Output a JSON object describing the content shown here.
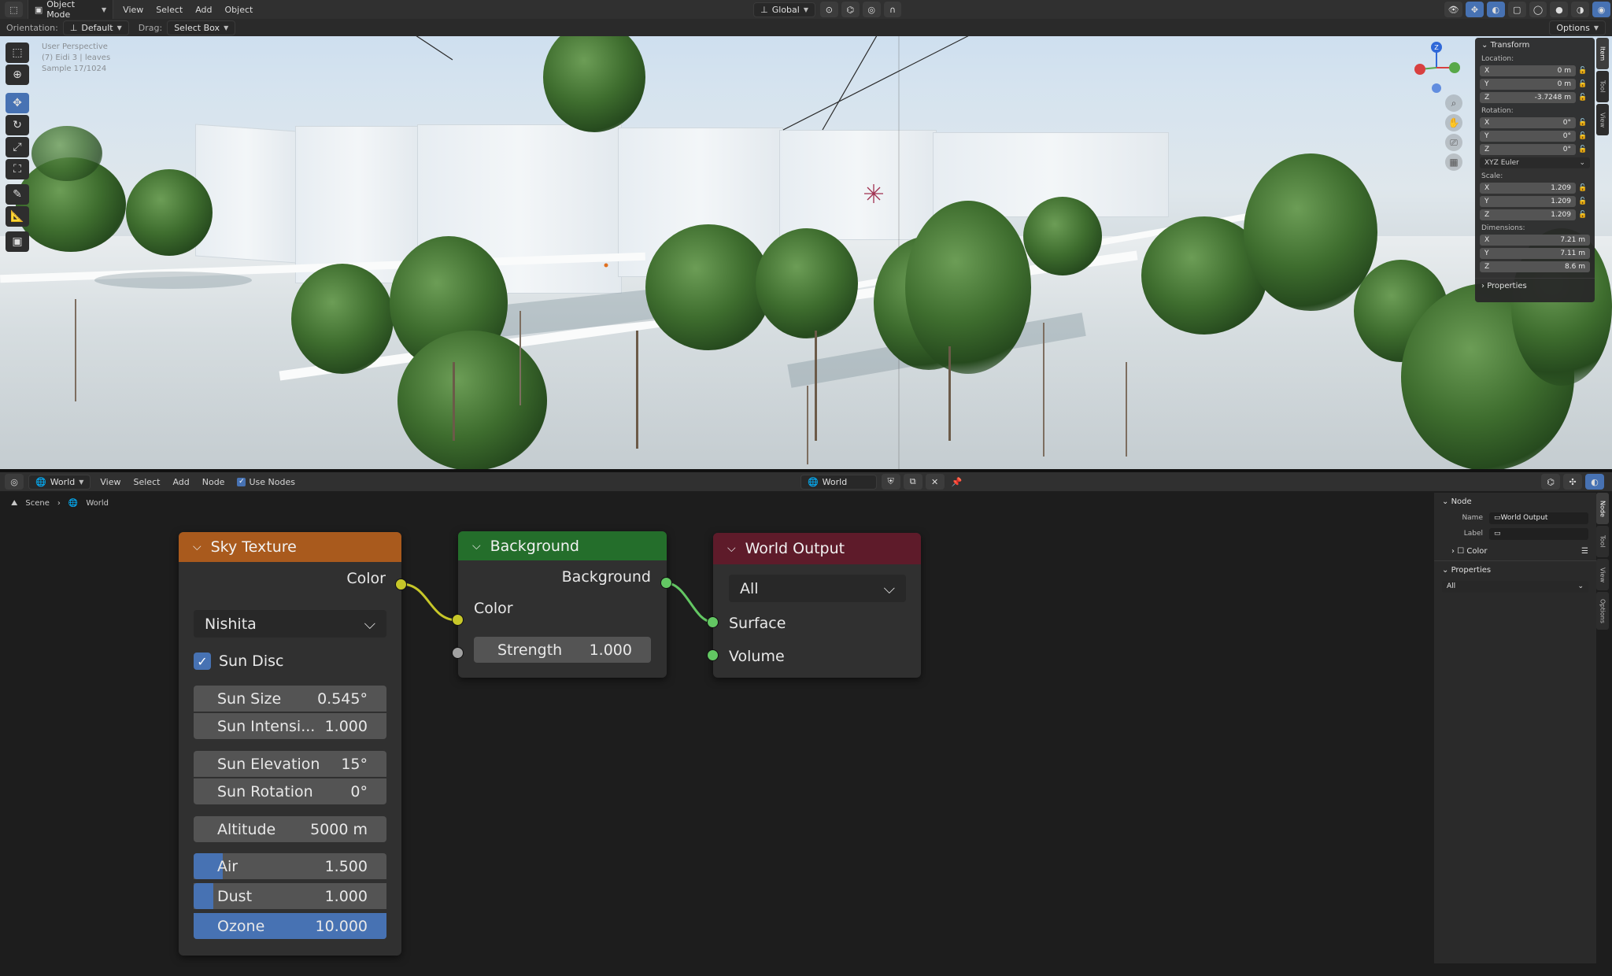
{
  "viewport_header": {
    "mode": "Object Mode",
    "menus": [
      "View",
      "Select",
      "Add",
      "Object"
    ],
    "transform_orientation": "Global",
    "options_label": "Options"
  },
  "tool_header": {
    "orientation_label": "Orientation:",
    "orientation_value": "Default",
    "drag_label": "Drag:",
    "drag_value": "Select Box"
  },
  "overlay": {
    "line1": "User Perspective",
    "line2": "(7) Eidi 3 | leaves",
    "line3": "Sample 17/1024"
  },
  "n_panel": {
    "section": "Transform",
    "location_label": "Location:",
    "location": [
      {
        "axis": "X",
        "value": "0 m"
      },
      {
        "axis": "Y",
        "value": "0 m"
      },
      {
        "axis": "Z",
        "value": "-3.7248 m"
      }
    ],
    "rotation_label": "Rotation:",
    "rotation": [
      {
        "axis": "X",
        "value": "0°"
      },
      {
        "axis": "Y",
        "value": "0°"
      },
      {
        "axis": "Z",
        "value": "0°"
      }
    ],
    "rotation_mode": "XYZ Euler",
    "scale_label": "Scale:",
    "scale": [
      {
        "axis": "X",
        "value": "1.209"
      },
      {
        "axis": "Y",
        "value": "1.209"
      },
      {
        "axis": "Z",
        "value": "1.209"
      }
    ],
    "dimensions_label": "Dimensions:",
    "dimensions": [
      {
        "axis": "X",
        "value": "7.21 m"
      },
      {
        "axis": "Y",
        "value": "7.11 m"
      },
      {
        "axis": "Z",
        "value": "8.6 m"
      }
    ],
    "properties_section": "Properties",
    "tabs": [
      "Item",
      "Tool",
      "View"
    ]
  },
  "node_header": {
    "world_selector": "World",
    "menus": [
      "View",
      "Select",
      "Add",
      "Node"
    ],
    "use_nodes_label": "Use Nodes",
    "datablock": "World"
  },
  "breadcrumb": {
    "scene": "Scene",
    "world": "World"
  },
  "sky_node": {
    "title": "Sky Texture",
    "output_color": "Color",
    "sky_type": "Nishita",
    "sun_disc_label": "Sun Disc",
    "sun_size": {
      "label": "Sun Size",
      "value": "0.545°"
    },
    "sun_intensity": {
      "label": "Sun Intensi...",
      "value": "1.000"
    },
    "sun_elevation": {
      "label": "Sun Elevation",
      "value": "15°"
    },
    "sun_rotation": {
      "label": "Sun Rotation",
      "value": "0°"
    },
    "altitude": {
      "label": "Altitude",
      "value": "5000 m"
    },
    "air": {
      "label": "Air",
      "value": "1.500",
      "fill": 0.15
    },
    "dust": {
      "label": "Dust",
      "value": "1.000",
      "fill": 0.1
    },
    "ozone": {
      "label": "Ozone",
      "value": "10.000",
      "fill": 1.0
    }
  },
  "background_node": {
    "title": "Background",
    "output_background": "Background",
    "input_color": "Color",
    "strength": {
      "label": "Strength",
      "value": "1.000"
    }
  },
  "world_output_node": {
    "title": "World Output",
    "target": "All",
    "input_surface": "Surface",
    "input_volume": "Volume"
  },
  "node_sidebar": {
    "section": "Node",
    "name_label": "Name",
    "name_value": "World Output",
    "label_label": "Label",
    "label_value": "",
    "color_section": "Color",
    "properties_section": "Properties",
    "target_value": "All",
    "tabs": [
      "Node",
      "Tool",
      "View",
      "Options"
    ]
  }
}
